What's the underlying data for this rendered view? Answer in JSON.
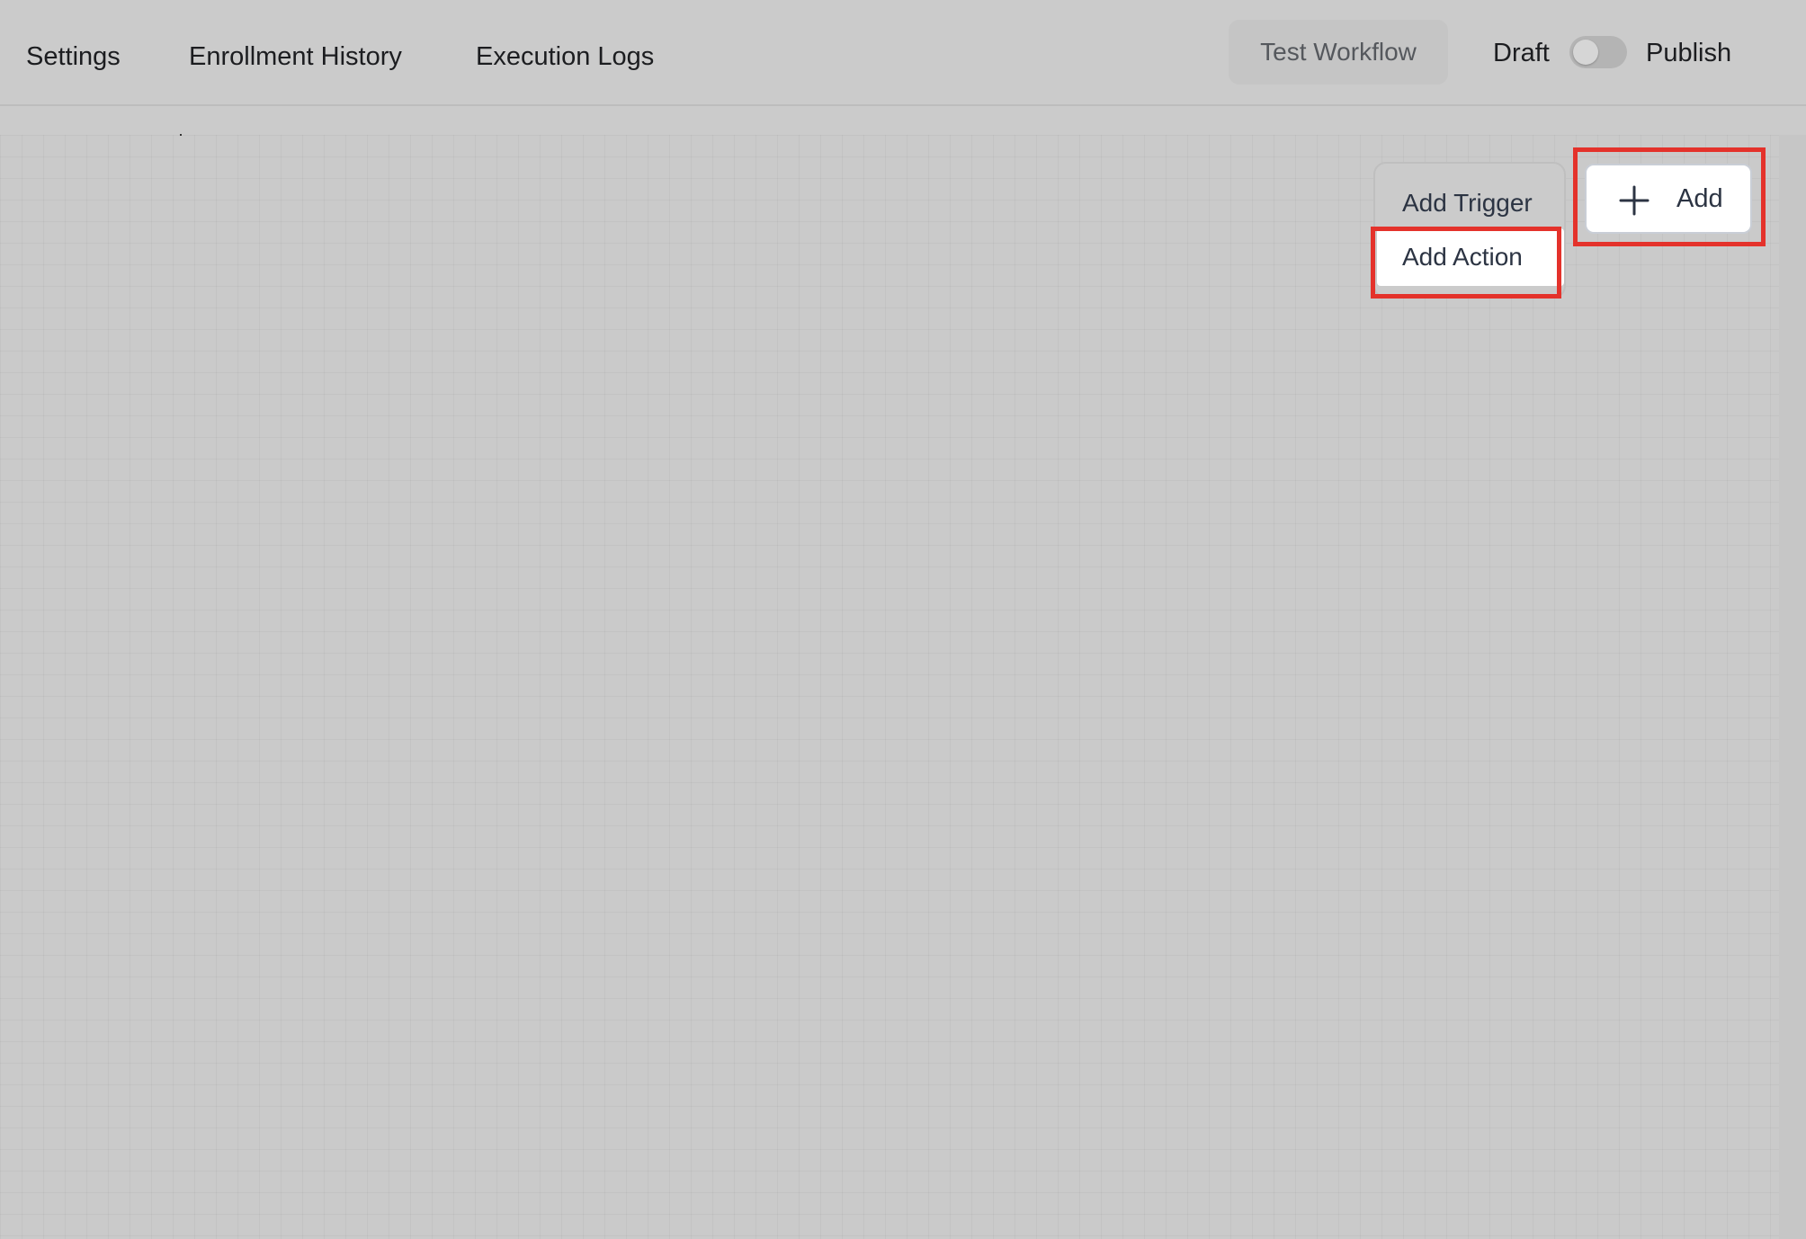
{
  "tabs": [
    {
      "label": "Settings"
    },
    {
      "label": "Enrollment History"
    },
    {
      "label": "Execution Logs"
    }
  ],
  "header": {
    "test_button_label": "Test Workflow",
    "draft_label": "Draft",
    "publish_label": "Publish",
    "publish_toggle_on": false
  },
  "add_menu": {
    "items": [
      {
        "label": "Add Trigger"
      },
      {
        "label": "Add Action"
      }
    ]
  },
  "add_button": {
    "label": "Add",
    "icon": "plus-icon"
  },
  "colors": {
    "highlight": "#e4322b",
    "background": "#cbcbcb",
    "text": "#1c1d20",
    "menu_text": "#2c3443"
  }
}
